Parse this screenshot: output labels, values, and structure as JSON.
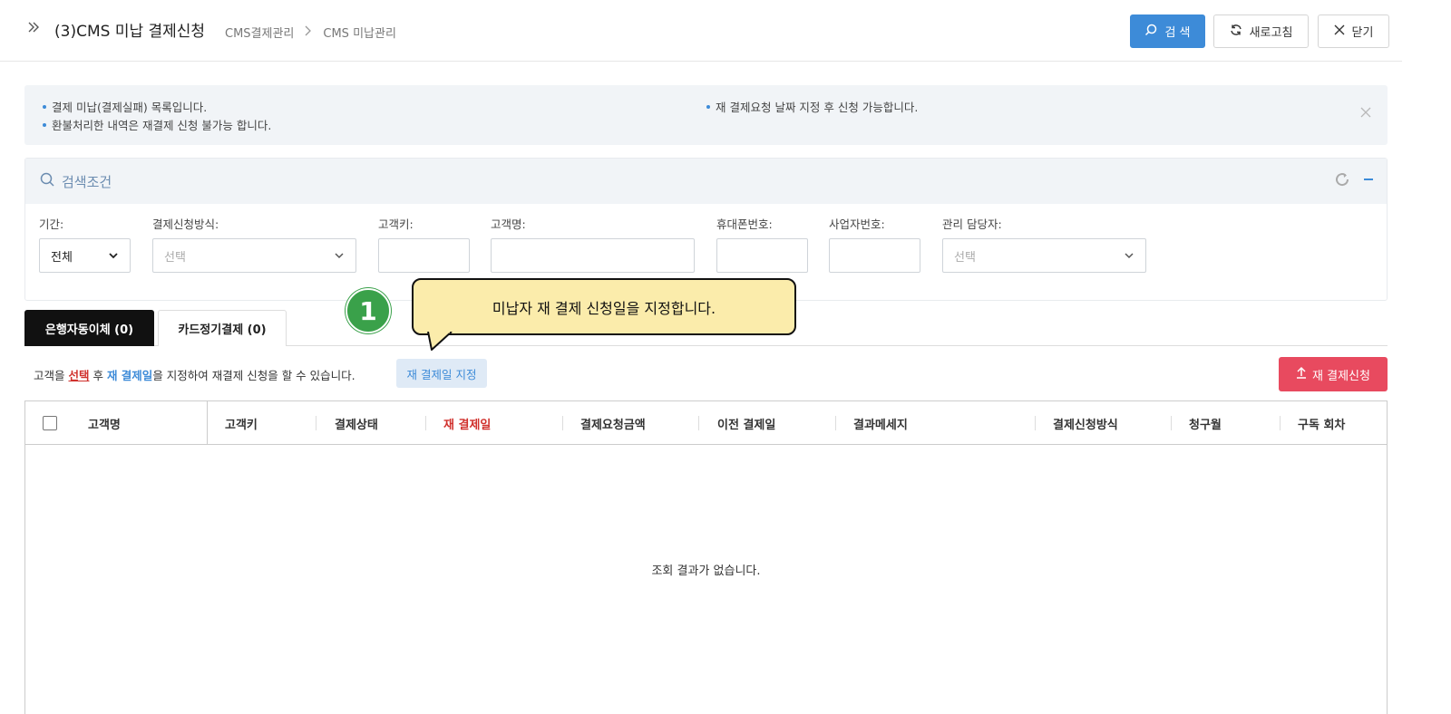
{
  "header": {
    "title": "(3)CMS 미납 결제신청",
    "breadcrumb": [
      "CMS결제관리",
      "CMS 미납관리"
    ],
    "buttons": {
      "search": "검 색",
      "refresh": "새로고침",
      "close": "닫기"
    }
  },
  "notice": {
    "items": [
      "결제 미납(결제실패) 목록입니다.",
      "환불처리한 내역은 재결제 신청 불가능 합니다.",
      "재 결제요청 날짜 지정 후 신청 가능합니다."
    ]
  },
  "search": {
    "title": "검색조건",
    "fields": {
      "period": {
        "label": "기간:",
        "value": "전체"
      },
      "method": {
        "label": "결제신청방식:",
        "placeholder": "선택"
      },
      "customer_key": {
        "label": "고객키:",
        "value": ""
      },
      "customer_name": {
        "label": "고객명:",
        "value": ""
      },
      "mobile": {
        "label": "휴대폰번호:",
        "value": ""
      },
      "biz_no": {
        "label": "사업자번호:",
        "value": ""
      },
      "manager": {
        "label": "관리 담당자:",
        "placeholder": "선택"
      }
    }
  },
  "tabs": [
    {
      "label": "은행자동이체 (0)",
      "active": true
    },
    {
      "label": "카드정기결제 (0)",
      "active": false
    }
  ],
  "toolbar": {
    "guide": {
      "part1": "고객을 ",
      "select": "선택",
      "part2": " 후 ",
      "redate": "재 결제일",
      "part3": "을 지정하여 재결제 신청을 할 수 있습니다."
    },
    "set_date_label": "재 결제일 지정",
    "reapply_label": "재 결제신청"
  },
  "grid": {
    "columns": [
      "고객명",
      "고객키",
      "결제상태",
      "재 결제일",
      "결제요청금액",
      "이전 결제일",
      "결과메세지",
      "결제신청방식",
      "청구월",
      "구독 회차"
    ],
    "rows": [],
    "empty_message": "조회 결과가 없습니다."
  },
  "callout": {
    "step": "1",
    "text": "미납자 재 결제 신청일을 지정합니다."
  },
  "colors": {
    "primary": "#3d8bd8",
    "danger": "#e84a5f",
    "highlight_text": "#d0312d",
    "badge": "#3aa14a",
    "bubble": "#fbecab"
  }
}
